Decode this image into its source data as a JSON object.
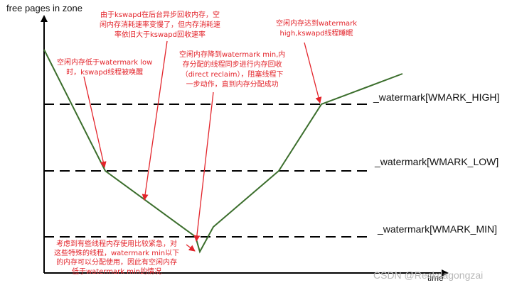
{
  "axes": {
    "y_label": "free pages in zone",
    "x_label": "time"
  },
  "watermarks": {
    "high": "_watermark[WMARK_HIGH]",
    "low": "_watermark[WMARK_LOW]",
    "min": "_watermark[WMARK_MIN]"
  },
  "annotations": {
    "below_low": [
      "空闲内存低于watermark low",
      "时，kswapd线程被唤醒"
    ],
    "slow_reclaim": [
      "由于kswapd在后台异步回收内存，空",
      "闲内存消耗速率变慢了，但内存消耗速",
      "率依旧大于kswapd回收速率"
    ],
    "below_min": [
      "空闲内存降到watermark min,内",
      "存分配的线程同步进行内存回收",
      "（direct reclaim），阻塞线程下",
      "一步动作，直到内存分配成功"
    ],
    "reach_high": [
      "空闲内存达到watermark",
      "high,kswapd线程睡眠"
    ],
    "emergency": [
      "考虑到有些线程内存使用比较紧急，对",
      "这些特殊的线程，watermark min以下",
      "的内存可以分配使用，因此有空闲内存",
      "低于watermark min的情况"
    ]
  },
  "source_watermark": "CSDN @Reckdagongzai",
  "colors": {
    "curve": "#3b6e2c",
    "annotation": "#e3242b",
    "axis": "#000000"
  }
}
